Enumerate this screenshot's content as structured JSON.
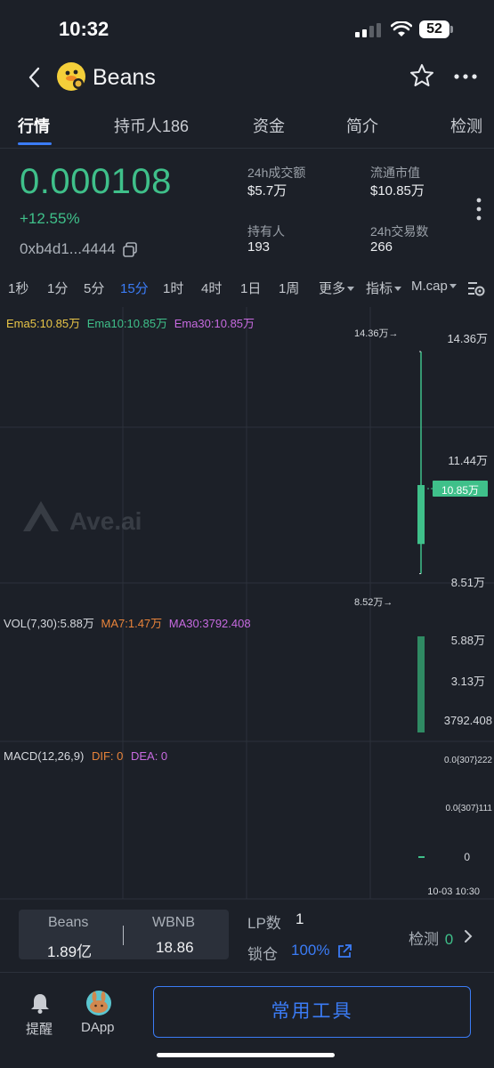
{
  "status_bar": {
    "time": "10:32",
    "battery": "52"
  },
  "nav": {
    "title": "Beans"
  },
  "tabs": [
    {
      "label": "行情",
      "active": true
    },
    {
      "label": "持币人186"
    },
    {
      "label": "资金"
    },
    {
      "label": "简介"
    },
    {
      "label": "检测"
    }
  ],
  "token": {
    "price": "0.000108",
    "change": "+12.55%",
    "address": "0xb4d1...4444"
  },
  "stats": {
    "vol24h_label": "24h成交额",
    "vol24h_value": "$5.7万",
    "mcap_label": "流通市值",
    "mcap_value": "$10.85万",
    "holders_label": "持有人",
    "holders_value": "193",
    "tx24h_label": "24h交易数",
    "tx24h_value": "266"
  },
  "intervals": [
    "1秒",
    "1分",
    "5分",
    "15分",
    "1时",
    "4时",
    "1日",
    "1周"
  ],
  "active_interval": "15分",
  "chart_controls": {
    "more": "更多",
    "indicators": "指标",
    "mcap": "M.cap"
  },
  "colors": {
    "up": "#3fc08a",
    "accent": "#3b7cf6",
    "ema5": "#e8c547",
    "ema10": "#3fc08a",
    "ema30": "#c76ae0",
    "ma7": "#e8833a"
  },
  "chart_data": {
    "type": "candlestick",
    "watermark": "Ave.ai",
    "price_panel": {
      "legend": {
        "ema5": "Ema5:10.85万",
        "ema10": "Ema10:10.85万",
        "ema30": "Ema30:10.85万"
      },
      "y_ticks": [
        "14.36万",
        "11.44万",
        "8.51万"
      ],
      "y_values": [
        143600,
        114400,
        85100
      ],
      "current_price_label": "10.85万",
      "high_marker": "14.36万→",
      "low_marker": "8.52万→",
      "candles": [
        {
          "open": 93000,
          "high": 143600,
          "low": 85200,
          "close": 108500
        }
      ]
    },
    "volume_panel": {
      "legend": {
        "vol": "VOL(7,30):5.88万",
        "ma7": "MA7:1.47万",
        "ma30": "MA30:3792.408"
      },
      "y_ticks": [
        "5.88万",
        "3.13万",
        "3792.408"
      ],
      "values": [
        58800
      ]
    },
    "macd_panel": {
      "legend": {
        "macd": "MACD(12,26,9)",
        "dif": "DIF: 0",
        "dea": "DEA: 0"
      },
      "y_ticks": [
        "0.0{307}222",
        "0.0{307}111",
        "0"
      ]
    },
    "x_label": "10-03 10:30"
  },
  "liquidity": {
    "base_symbol": "Beans",
    "base_amount": "1.89亿",
    "quote_symbol": "WBNB",
    "quote_amount": "18.86",
    "lp_label": "LP数",
    "lp_value": "1",
    "lock_label": "锁仓",
    "lock_value": "100%",
    "check_label": "检测",
    "check_value": "0"
  },
  "footer": {
    "alert_label": "提醒",
    "dapp_label": "DApp",
    "tools_label": "常用工具"
  }
}
